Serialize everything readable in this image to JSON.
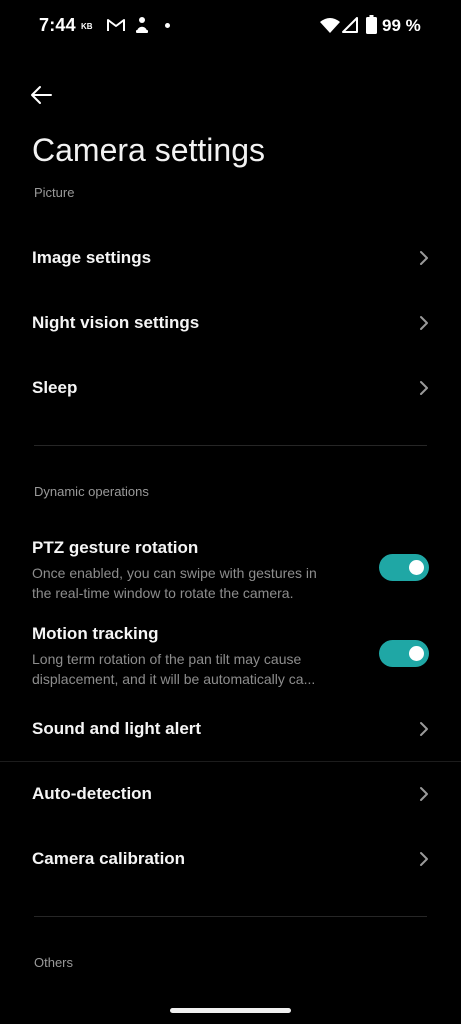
{
  "status_bar": {
    "time": "7:44",
    "kb": "KB",
    "battery": "99 %",
    "icons": [
      "gmail-icon",
      "app-notification-icon",
      "wifi-icon",
      "signal-icon",
      "battery-icon"
    ]
  },
  "header": {
    "back_icon": "arrow-left-icon",
    "title": "Camera settings"
  },
  "sections": {
    "picture": {
      "header": "Picture",
      "items": [
        {
          "label": "Image settings"
        },
        {
          "label": "Night vision settings"
        },
        {
          "label": "Sleep"
        }
      ]
    },
    "dynamic": {
      "header": "Dynamic operations",
      "ptz": {
        "label": "PTZ gesture rotation",
        "desc_line1": "Once enabled, you can swipe with gestures in",
        "desc_line2": "the real-time window to rotate the camera.",
        "enabled": true
      },
      "motion": {
        "label": "Motion tracking",
        "desc_line1": "Long term rotation of the pan tilt may cause",
        "desc_line2": "displacement, and it will be automatically ca...",
        "enabled": true
      },
      "items": [
        {
          "label": "Sound and light alert"
        },
        {
          "label": "Auto-detection"
        },
        {
          "label": "Camera calibration"
        }
      ]
    },
    "others": {
      "header": "Others"
    }
  },
  "colors": {
    "background": "#000000",
    "accent_toggle": "#1fa7a5",
    "secondary_text": "#8d8d8d"
  }
}
